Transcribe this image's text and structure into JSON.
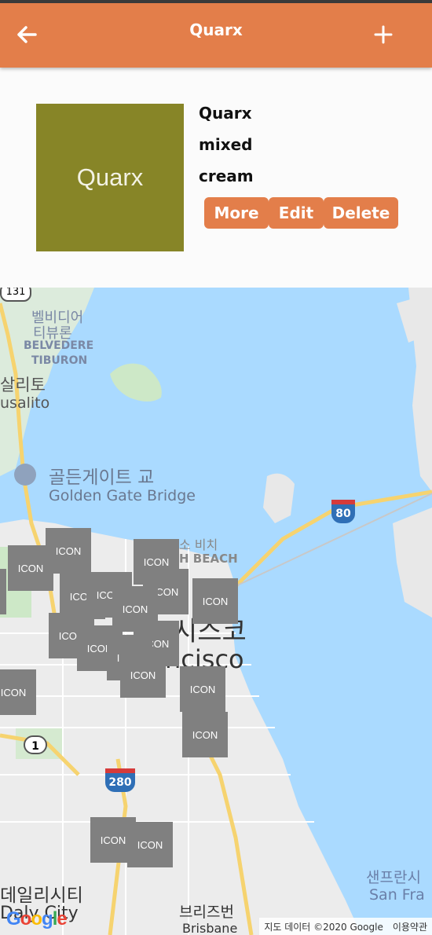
{
  "header": {
    "title": "Quarx",
    "back_icon": "arrow-left-icon",
    "add_icon": "plus-icon",
    "color": "#e37e4a"
  },
  "item": {
    "thumbnail_text": "Quarx",
    "thumbnail_color": "#878527",
    "name": "Quarx",
    "type": "mixed",
    "flavor": "cream"
  },
  "actions": {
    "more": "More",
    "edit": "Edit",
    "delete": "Delete"
  },
  "map": {
    "labels": {
      "belvedere_ko": "벨비디어",
      "tiburon_ko": "티뷰론",
      "belvedere": "BELVEDERE",
      "tiburon": "TIBURON",
      "sausalito_ko": "살리토",
      "sausalito": "usalito",
      "golden_gate_ko": "골든게이트 교",
      "golden_gate": "Golden Gate Bridge",
      "beach_ko": "소 비치",
      "north_beach": "H BEACH",
      "sf_ko": "시스코",
      "sf": "ncisco",
      "daly_city_ko": "데일리시티",
      "daly_city": "Daly City",
      "brisbane_ko": "브리즈번",
      "brisbane": "Brisbane",
      "san_fran_ko": "샌프란시",
      "san_fran": "San Fra",
      "hwy_131": "131",
      "hwy_80": "80",
      "hwy_1": "1",
      "hwy_280": "280"
    },
    "marker_label": "ICON",
    "marker_partial": {
      "ic": "IC",
      "con": "CON",
      "icon_i": "ICON",
      "i_con": "CON"
    },
    "attribution": "지도 데이터 ©2020 Google",
    "terms": "이용약관",
    "logo": "Google"
  }
}
